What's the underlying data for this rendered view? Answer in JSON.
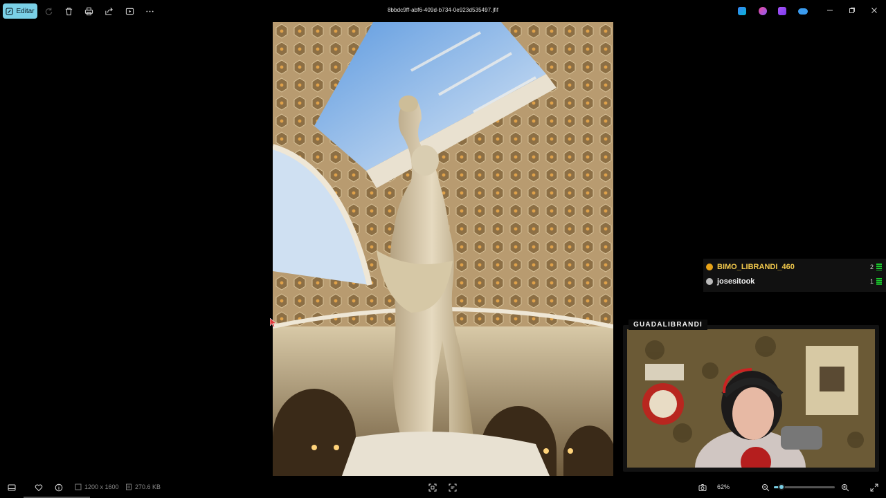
{
  "toolbar": {
    "edit_label": "Editar",
    "icons": [
      "rotate-icon",
      "delete-icon",
      "print-icon",
      "share-icon",
      "slideshow-icon",
      "more-icon"
    ]
  },
  "window": {
    "title": "8bbdc9ff-abf6-409d-b734-0e923d535497.jfif"
  },
  "stream": {
    "chat": [
      {
        "name": "BIMO_LIBRANDI_460",
        "count": "2",
        "badge_color": "#e8a317",
        "name_color": "#f2c94c"
      },
      {
        "name": "josesitook",
        "count": "1",
        "badge_color": "#bbbbbb",
        "name_color": "#f2f2f2"
      }
    ],
    "channel_name": "GUADALIBRANDI"
  },
  "statusbar": {
    "dimensions": "1200 x 1600",
    "file_size": "270.6 KB",
    "zoom": "62%",
    "zoom_fraction": 0.12
  },
  "colors": {
    "accent": "#7ad0e6",
    "background": "#000000"
  }
}
